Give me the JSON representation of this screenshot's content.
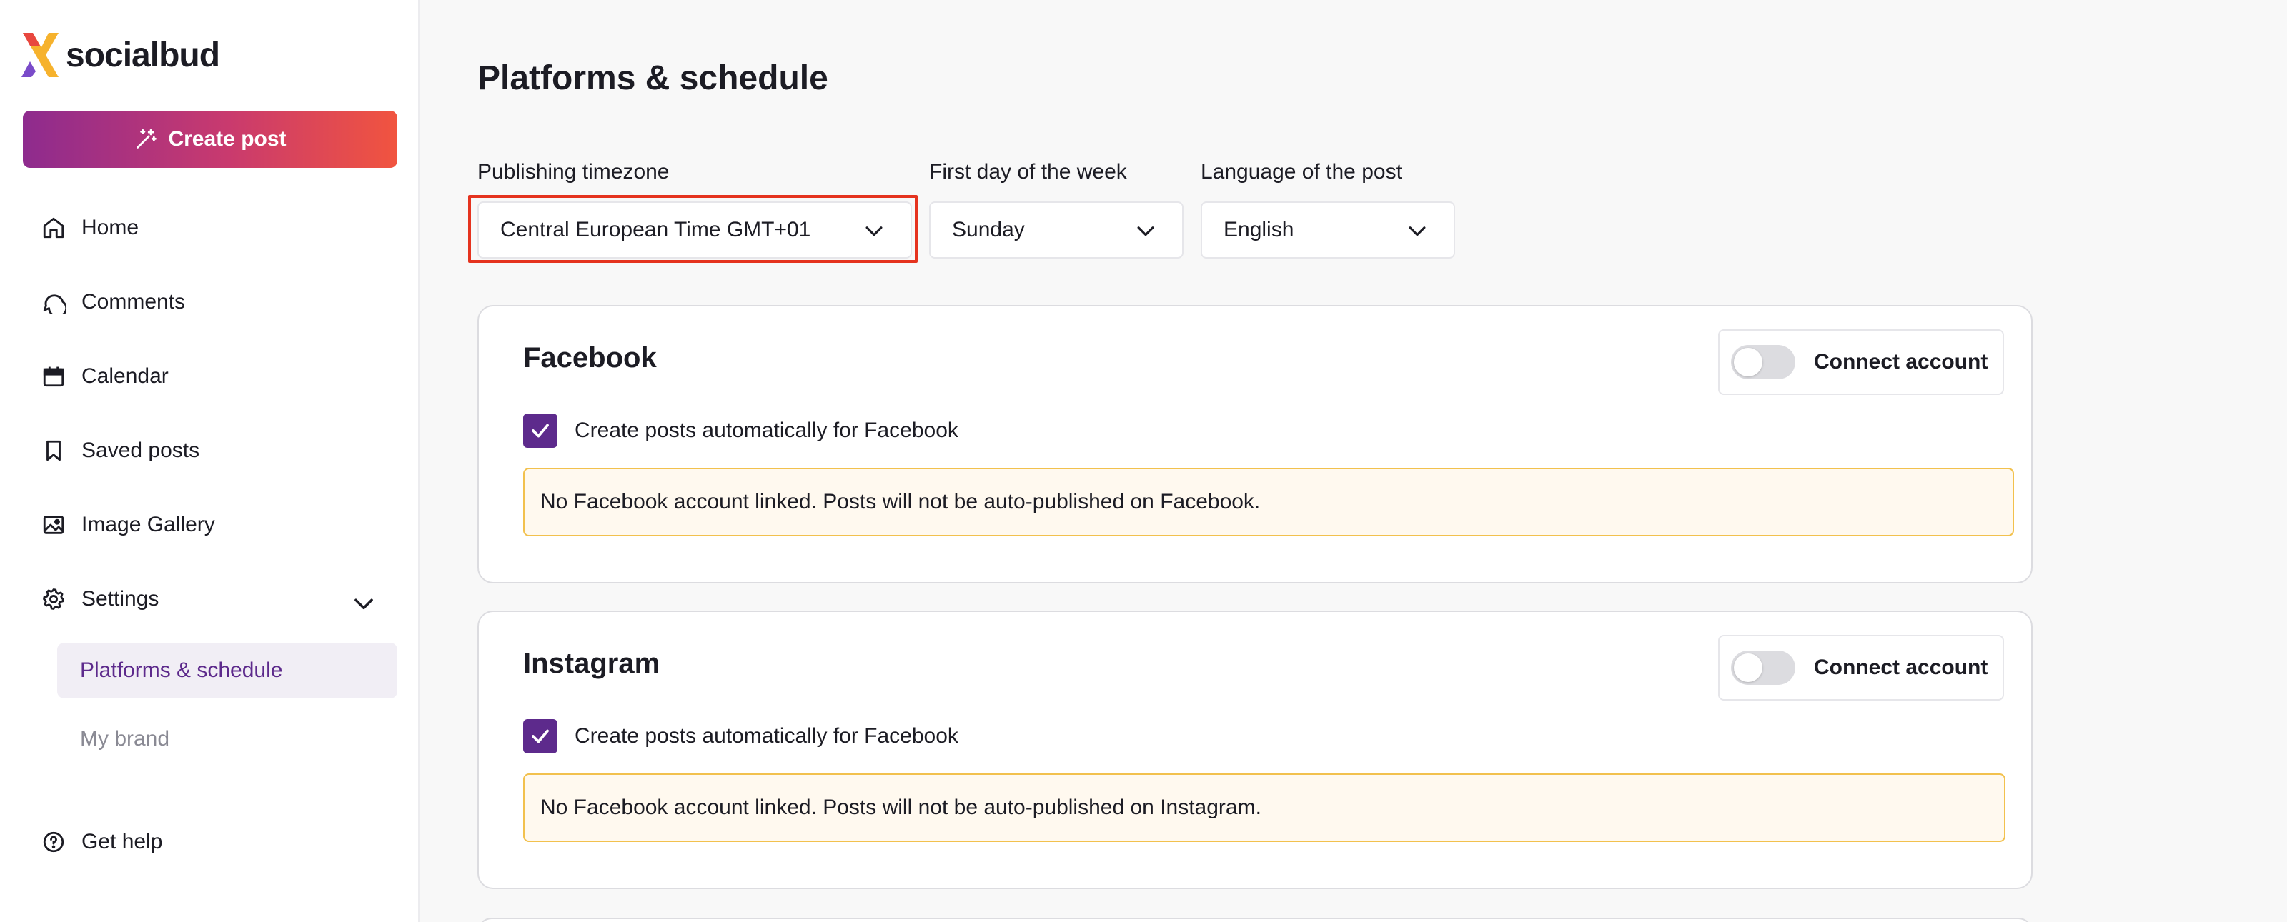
{
  "brand": {
    "name": "socialbud"
  },
  "sidebar": {
    "create_post_label": "Create post",
    "items": [
      {
        "label": "Home",
        "icon": "home-icon"
      },
      {
        "label": "Comments",
        "icon": "comment-icon"
      },
      {
        "label": "Calendar",
        "icon": "calendar-icon"
      },
      {
        "label": "Saved posts",
        "icon": "bookmark-icon"
      },
      {
        "label": "Image Gallery",
        "icon": "image-icon"
      },
      {
        "label": "Settings",
        "icon": "gear-icon",
        "expanded": true
      }
    ],
    "settings_subitems": [
      {
        "label": "Platforms & schedule",
        "active": true
      },
      {
        "label": "My brand",
        "active": false
      }
    ],
    "help_label": "Get help"
  },
  "main": {
    "title": "Platforms & schedule",
    "fields": {
      "timezone": {
        "label": "Publishing timezone",
        "value": "Central European Time GMT+01"
      },
      "first_day": {
        "label": "First day of the week",
        "value": "Sunday"
      },
      "language": {
        "label": "Language of the post",
        "value": "English"
      }
    },
    "platforms": [
      {
        "name": "Facebook",
        "connect_label": "Connect account",
        "connected": false,
        "auto_create_label": "Create posts automatically for Facebook",
        "auto_create_checked": true,
        "warning": "No Facebook account linked. Posts will not be auto-published on Facebook."
      },
      {
        "name": "Instagram",
        "connect_label": "Connect account",
        "connected": false,
        "auto_create_label": "Create posts automatically for Facebook",
        "auto_create_checked": true,
        "warning": "No Facebook account linked. Posts will not be auto-published on Instagram."
      }
    ]
  },
  "colors": {
    "accent_purple": "#5d2a8c",
    "highlight_red": "#e5331f",
    "warning_border": "#f2c14e",
    "warning_bg": "#fff9ef",
    "gradient_start": "#8e2b8e",
    "gradient_end": "#f1543f"
  }
}
